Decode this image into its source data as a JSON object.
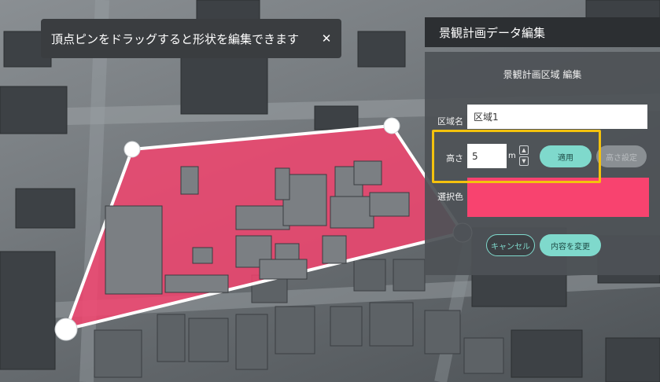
{
  "toast": {
    "message": "頂点ピンをドラッグすると形状を編集できます",
    "close_glyph": "✕"
  },
  "panel": {
    "title": "景観計画データ編集",
    "subtitle": "景観計画区域 編集",
    "area_name_label": "区域名",
    "area_name_value": "区域1",
    "height_label": "高さ",
    "height_value": "5",
    "height_unit": "m",
    "stepper_up": "▲",
    "stepper_down": "▼",
    "apply_label": "適用",
    "reset_label": "高さ設定",
    "color_label": "選択色",
    "cancel_label": "キャンセル",
    "save_label": "内容を変更"
  },
  "colors": {
    "area_fill": "#f8436f",
    "accent": "#7fd9cc",
    "highlight": "#f4c20d",
    "selected_color": "#f8436f"
  }
}
